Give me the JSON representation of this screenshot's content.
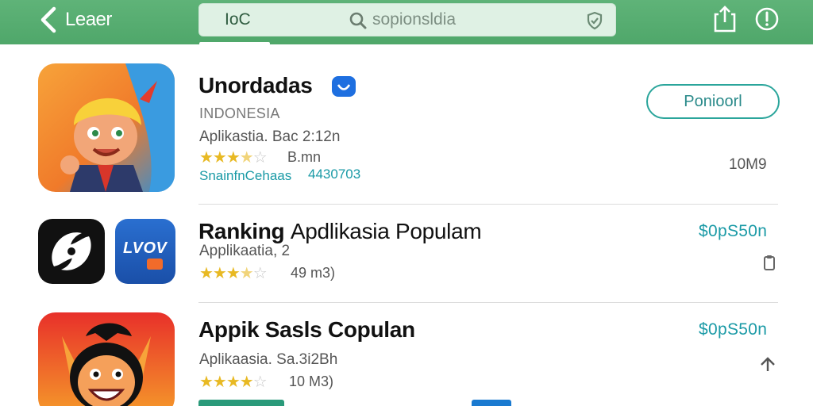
{
  "topbar": {
    "back_label": "Leaer",
    "search_tab": "IoC",
    "search_placeholder": "sopionsldia"
  },
  "apps": [
    {
      "title": "Unordadas",
      "subtitle": "INDONESIA",
      "category": "Aplikastia. Bac 2:12n",
      "rating_stars": 3.5,
      "rating_text": "B.mn",
      "developer": "SnainfnCehaas",
      "developer_count": "4430703",
      "size": "10M9",
      "action_label": "Ponioorl"
    },
    {
      "title_bold": "Ranking",
      "title_rest": "Apdlikasia Populam",
      "category": "Applikaatia, 2",
      "rating_stars": 3.5,
      "rating_text": "49 m3)",
      "price": "$0pS50n",
      "icon2_text": "LVOV"
    },
    {
      "title": "Appik Sasls Copulan",
      "category": "Aplikaasia. Sa.3i2Bh",
      "rating_stars": 4.5,
      "rating_text": "10 M3)",
      "price": "$0pS50n"
    }
  ],
  "colors": {
    "topbar": "#4fa76a",
    "accent": "#1a9aa6",
    "star": "#e8b923"
  }
}
